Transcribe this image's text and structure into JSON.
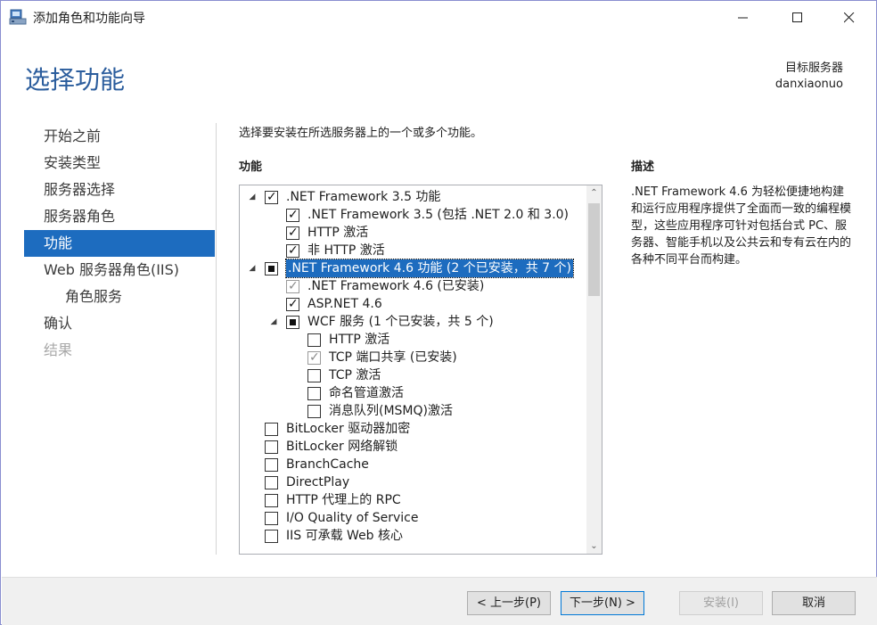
{
  "window": {
    "title": "添加角色和功能向导"
  },
  "header": {
    "page_title": "选择功能",
    "dest_label": "目标服务器",
    "dest_server": "danxiaonuo"
  },
  "nav": {
    "items": [
      {
        "label": "开始之前",
        "state": "normal"
      },
      {
        "label": "安装类型",
        "state": "normal"
      },
      {
        "label": "服务器选择",
        "state": "normal"
      },
      {
        "label": "服务器角色",
        "state": "normal"
      },
      {
        "label": "功能",
        "state": "active"
      },
      {
        "label": "Web 服务器角色(IIS)",
        "state": "normal"
      },
      {
        "label": "角色服务",
        "state": "sub"
      },
      {
        "label": "确认",
        "state": "normal"
      },
      {
        "label": "结果",
        "state": "disabled"
      }
    ]
  },
  "main": {
    "intro": "选择要安装在所选服务器上的一个或多个功能。",
    "features_heading": "功能",
    "description_heading": "描述",
    "description": ".NET Framework 4.6 为轻松便捷地构建和运行应用程序提供了全面而一致的编程模型，这些应用程序可针对包括台式 PC、服务器、智能手机以及公共云和专有云在内的各种不同平台而构建。",
    "features": [
      {
        "label": ".NET Framework 3.5 功能",
        "level": 0,
        "expander": "expanded",
        "check": "checked"
      },
      {
        "label": ".NET Framework 3.5 (包括 .NET 2.0 和 3.0)",
        "level": 1,
        "expander": "",
        "check": "checked"
      },
      {
        "label": "HTTP 激活",
        "level": 1,
        "expander": "",
        "check": "checked"
      },
      {
        "label": "非 HTTP 激活",
        "level": 1,
        "expander": "",
        "check": "checked"
      },
      {
        "label": ".NET Framework 4.6 功能 (2 个已安装，共 7 个)",
        "level": 0,
        "expander": "expanded",
        "check": "partial",
        "selected": true
      },
      {
        "label": ".NET Framework 4.6 (已安装)",
        "level": 1,
        "expander": "",
        "check": "gray"
      },
      {
        "label": "ASP.NET 4.6",
        "level": 1,
        "expander": "",
        "check": "checked"
      },
      {
        "label": "WCF 服务 (1 个已安装，共 5 个)",
        "level": 1,
        "expander": "expanded",
        "check": "partial"
      },
      {
        "label": "HTTP 激活",
        "level": 2,
        "expander": "",
        "check": "unchecked"
      },
      {
        "label": "TCP 端口共享 (已安装)",
        "level": 2,
        "expander": "",
        "check": "gray"
      },
      {
        "label": "TCP 激活",
        "level": 2,
        "expander": "",
        "check": "unchecked"
      },
      {
        "label": "命名管道激活",
        "level": 2,
        "expander": "",
        "check": "unchecked"
      },
      {
        "label": "消息队列(MSMQ)激活",
        "level": 2,
        "expander": "",
        "check": "unchecked"
      },
      {
        "label": "BitLocker 驱动器加密",
        "level": 0,
        "expander": "",
        "check": "unchecked"
      },
      {
        "label": "BitLocker 网络解锁",
        "level": 0,
        "expander": "",
        "check": "unchecked"
      },
      {
        "label": "BranchCache",
        "level": 0,
        "expander": "",
        "check": "unchecked"
      },
      {
        "label": "DirectPlay",
        "level": 0,
        "expander": "",
        "check": "unchecked"
      },
      {
        "label": "HTTP 代理上的 RPC",
        "level": 0,
        "expander": "",
        "check": "unchecked"
      },
      {
        "label": "I/O Quality of Service",
        "level": 0,
        "expander": "",
        "check": "unchecked"
      },
      {
        "label": "IIS 可承载 Web 核心",
        "level": 0,
        "expander": "",
        "check": "unchecked"
      }
    ]
  },
  "footer": {
    "prev_label": "< 上一步(P)",
    "next_label": "下一步(N) >",
    "install_label": "安装(I)",
    "cancel_label": "取消"
  }
}
